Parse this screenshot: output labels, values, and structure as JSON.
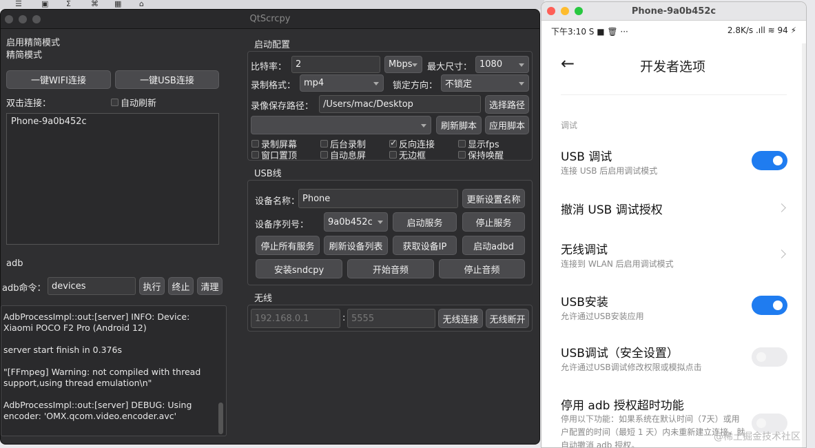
{
  "qt": {
    "title": "QtScrcpy",
    "simple_mode_check": "启用精简模式",
    "simple_mode_label": "精简模式",
    "wifi_btn": "一键WIFI连接",
    "usb_btn": "一键USB连接",
    "dbl_connect": "双击连接：",
    "auto_refresh": "自动刷新",
    "device_list": [
      "Phone-9a0b452c"
    ],
    "adb_section": "adb",
    "adb_cmd_label": "adb命令：",
    "adb_cmd_value": "devices",
    "exec_btn": "执行",
    "stop_btn": "终止",
    "clear_btn": "清理",
    "log": [
      "AdbProcessImpl::out:[server] INFO: Device: Xiaomi POCO F2 Pro (Android 12)",
      "server start finish in 0.376s",
      "\"[FFmpeg] Warning: not compiled with thread support,using thread emulation\\n\"",
      "AdbProcessImpl::out:[server] DEBUG: Using encoder: 'OMX.qcom.video.encoder.avc'"
    ],
    "start_config": {
      "title": "启动配置",
      "bitrate_label": "比特率：",
      "bitrate_value": "2",
      "bitrate_unit": "Mbps",
      "max_size_label": "最大尺寸：",
      "max_size_value": "1080",
      "record_format_label": "录制格式：",
      "record_format_value": "mp4",
      "lock_orient_label": "锁定方向：",
      "lock_orient_value": "不锁定",
      "save_path_label": "录像保存路径：",
      "save_path_value": "/Users/mac/Desktop",
      "choose_path_btn": "选择路径",
      "refresh_script_btn": "刷新脚本",
      "apply_script_btn": "应用脚本",
      "checks": [
        {
          "label": "录制屏幕",
          "on": false
        },
        {
          "label": "后台录制",
          "on": false
        },
        {
          "label": "反向连接",
          "on": true
        },
        {
          "label": "显示fps",
          "on": false
        },
        {
          "label": "窗口置顶",
          "on": false
        },
        {
          "label": "自动息屏",
          "on": false
        },
        {
          "label": "无边框",
          "on": false
        },
        {
          "label": "保持唤醒",
          "on": false
        }
      ]
    },
    "usb": {
      "title": "USB线",
      "device_name_label": "设备名称：",
      "device_name_value": "Phone",
      "update_name_btn": "更新设置名称",
      "serial_label": "设备序列号：",
      "serial_value": "9a0b452c",
      "start_service_btn": "启动服务",
      "stop_service_btn": "停止服务",
      "stop_all_btn": "停止所有服务",
      "refresh_list_btn": "刷新设备列表",
      "get_ip_btn": "获取设备IP",
      "start_adbd_btn": "启动adbd",
      "install_sndcpy_btn": "安装sndcpy",
      "start_audio_btn": "开始音频",
      "stop_audio_btn": "停止音频"
    },
    "wireless": {
      "title": "无线",
      "ip_placeholder": "192.168.0.1",
      "colon": ":",
      "port_placeholder": "5555",
      "connect_btn": "无线连接",
      "disconnect_btn": "无线断开"
    }
  },
  "phone": {
    "window_title": "Phone-9a0b452c",
    "status_left": "下午3:10 S  ■  🗑  ···",
    "status_right": "2.8K/s  .ıll  ≋  94 ⚡",
    "page_title": "开发者选项",
    "section": "调试",
    "items": [
      {
        "title": "USB 调试",
        "sub": "连接 USB 后启用调试模式",
        "control": "toggle-on"
      },
      {
        "title": "撤消 USB 调试授权",
        "sub": "",
        "control": "chevron"
      },
      {
        "title": "无线调试",
        "sub": "连接到 WLAN 后启用调试模式",
        "control": "chevron"
      },
      {
        "title": "USB安装",
        "sub": "允许通过USB安装应用",
        "control": "toggle-on"
      },
      {
        "title": "USB调试（安全设置）",
        "sub": "允许通过USB调试修改权限或模拟点击",
        "control": "toggle-off"
      },
      {
        "title": "停用 adb 授权超时功能",
        "sub": "停用以下功能：如果系统在默认时间（7天）或用户配置的时间（最短 1 天）内未重新建立连接，就自动撤消 adb 授权。",
        "control": "toggle-off"
      }
    ],
    "watermark": "@稀土掘金技术社区"
  },
  "colors": {
    "accent": "#1f7cf0",
    "qt_bg": "#2f2f31"
  }
}
